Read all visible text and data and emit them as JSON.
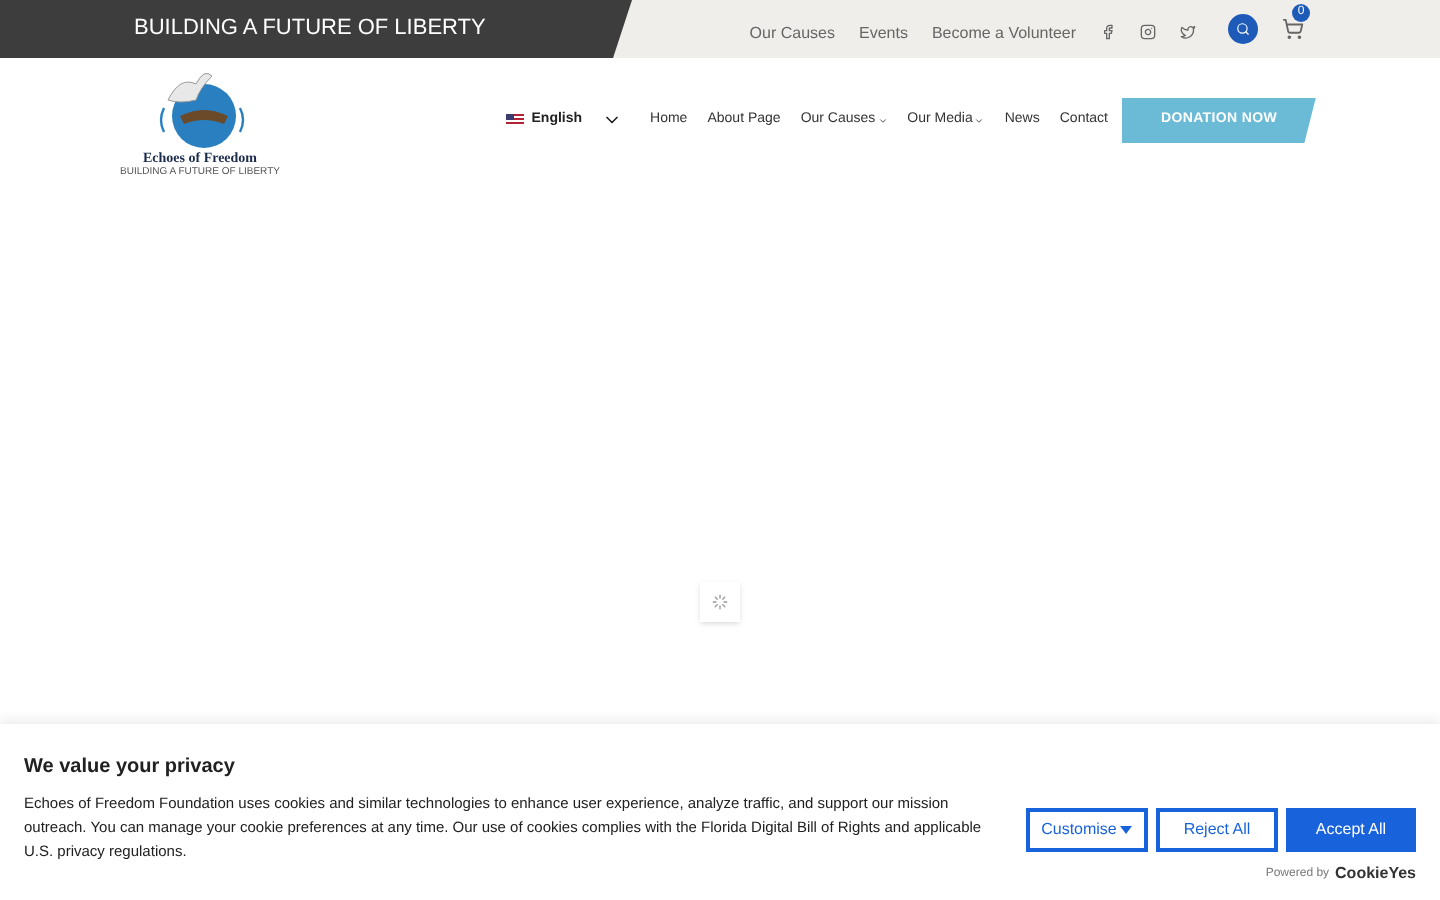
{
  "topbar": {
    "tagline": "BUILDING A FUTURE OF LIBERTY",
    "links": [
      "Our Causes",
      "Events",
      "Become a Volunteer"
    ],
    "cart_count": "0"
  },
  "logo": {
    "name": "Echoes of Freedom",
    "tagline": "BUILDING A FUTURE OF LIBERTY"
  },
  "language": "English",
  "nav": [
    {
      "label": "Home",
      "dropdown": false
    },
    {
      "label": "About Page",
      "dropdown": false
    },
    {
      "label": "Our Causes",
      "dropdown": true
    },
    {
      "label": "Our Media",
      "dropdown": true
    },
    {
      "label": "News",
      "dropdown": false
    },
    {
      "label": "Contact",
      "dropdown": false
    }
  ],
  "donate_button": "DONATION NOW",
  "cookie_banner": {
    "title": "We value your privacy",
    "text": "Echoes of Freedom Foundation uses cookies and similar technologies to enhance user experience, analyze traffic, and support our mission outreach. You can manage your cookie preferences at any time. Our use of cookies complies with the Florida Digital Bill of Rights and applicable U.S. privacy regulations.",
    "buttons": [
      {
        "label": "Customise",
        "kind": "dropdown"
      },
      {
        "label": "Reject All",
        "kind": "outline"
      },
      {
        "label": "Accept All",
        "kind": "primary"
      }
    ],
    "powered_by": "Powered by",
    "brand": "CookieYes"
  }
}
